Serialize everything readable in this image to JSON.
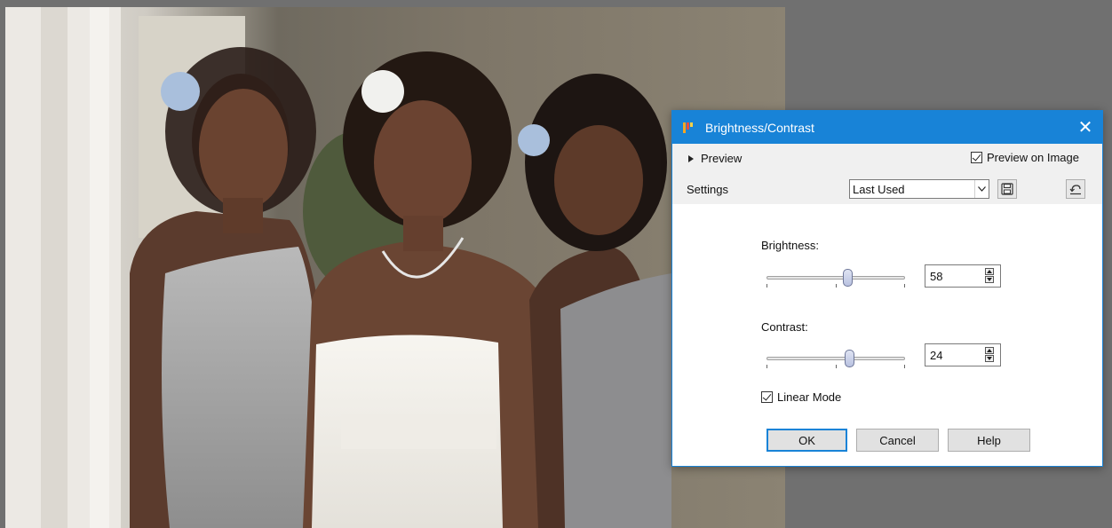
{
  "dialog": {
    "title": "Brightness/Contrast",
    "close_glyph": "✕",
    "preview_label": "Preview",
    "preview_on_image_label": "Preview on Image",
    "preview_on_image_checked": true,
    "settings_label": "Settings",
    "settings_value": "Last Used",
    "brightness": {
      "label": "Brightness:",
      "value": "58"
    },
    "contrast": {
      "label": "Contrast:",
      "value": "24"
    },
    "linear_mode_label": "Linear Mode",
    "linear_mode_checked": true,
    "buttons": {
      "ok": "OK",
      "cancel": "Cancel",
      "help": "Help"
    }
  },
  "icons": {
    "app": "paintshop-icon",
    "save_preset": "floppy-disk-icon",
    "reset": "reset-icon",
    "dropdown": "chevron-down-icon"
  },
  "colors": {
    "accent": "#1883d7",
    "background": "#707070",
    "dialog_body": "#ffffff"
  }
}
